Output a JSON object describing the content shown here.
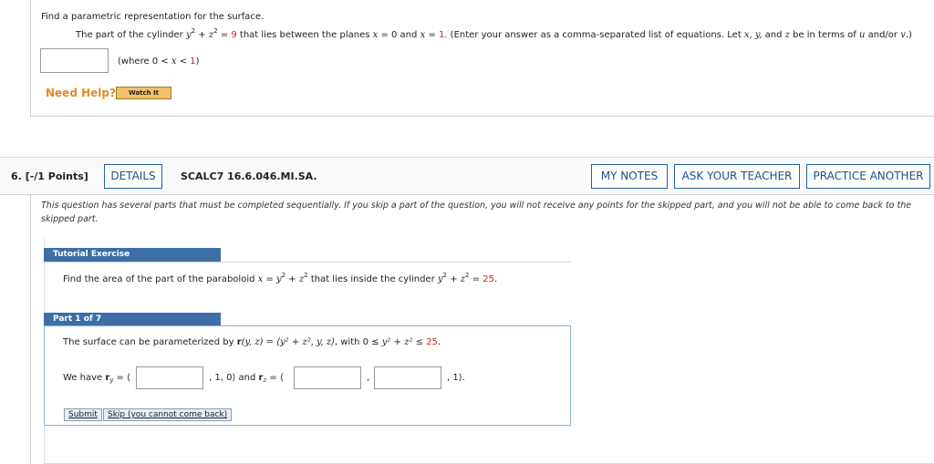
{
  "q5": {
    "prompt": "Find a parametric representation for the surface.",
    "sentence": {
      "t1": "The part of the cylinder ",
      "y": "y",
      "exp": "2",
      "plus": " + ",
      "z": "z",
      "eq": " = ",
      "nine": "9",
      "t2": " that lies between the planes ",
      "x": "x",
      "eq0": " = 0 and ",
      "x2": "x",
      "eq1a": " = ",
      "one": "1",
      "t3": ". (Enter your answer as a comma-separated list of equations. Let ",
      "vars": "x, y,",
      "t4": " and ",
      "zvar": "z",
      "t5": " be in terms of ",
      "u": "u",
      "t6": " and/or ",
      "v": "v",
      "t7": ".)"
    },
    "where": {
      "prefix": "(where 0 < ",
      "x": "x",
      "mid": " < ",
      "one": "1",
      "suffix": ")"
    },
    "need_help": "Need Help?",
    "watch_label": "Watch It"
  },
  "q6": {
    "number": "6.",
    "points": "[-/1 Points]",
    "details": "DETAILS",
    "code": "SCALC7 16.6.046.MI.SA.",
    "my_notes": "MY NOTES",
    "ask_teacher": "ASK YOUR TEACHER",
    "practice": "PRACTICE ANOTHER",
    "notice_line1": "This question has several parts that must be completed sequentially. If you skip a part of the question, you will not receive any points for the skipped part, and you will not be able to come back to the",
    "notice_line2": "skipped part.",
    "tutorial_label": "Tutorial Exercise",
    "problem": {
      "t1": "Find the area of the part of the paraboloid ",
      "x": "x",
      "eq": " = ",
      "y": "y",
      "exp": "2",
      "plus": " + ",
      "z": "z",
      "t2": " that lies inside the cylinder ",
      "y2": "y",
      "plus2": " + ",
      "z2": "z",
      "eq2": " = ",
      "val": "25",
      "end": "."
    },
    "part_label": "Part 1 of 7",
    "param": {
      "t1": "The surface can be parameterized by ",
      "r": "r",
      "args": "(y, z) = ",
      "vec": "⟨y² + z², y, z⟩",
      "with": ",  with  0 ≤ ",
      "ineq": "y² + z² ≤ ",
      "val": "25",
      "end": "."
    },
    "have": {
      "we_have": "We have ",
      "ry": "r",
      "ry_sub": "y",
      "eq": " = ⟨",
      "mid": ", 1, 0⟩  and ",
      "rz": "r",
      "rz_sub": "z",
      "eq2": " = ⟨",
      "comma": ",",
      "tail": ", 1⟩."
    },
    "submit": "Submit",
    "skip": "Skip (you cannot come back)"
  }
}
